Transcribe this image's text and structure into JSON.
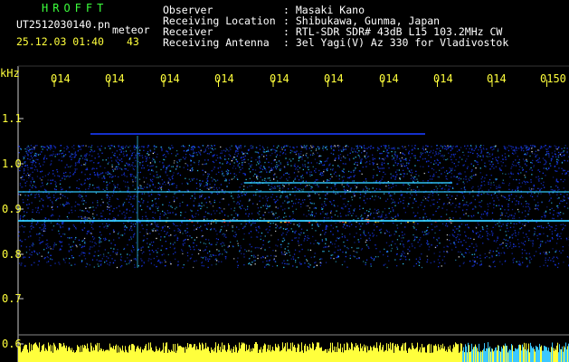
{
  "header": {
    "app_name": "HROFFT",
    "filename": "UT2512030140.pn",
    "meteor_label": "meteor",
    "datetime": "25.12.03 01:40",
    "count": "43"
  },
  "info": {
    "labels": [
      "Observer",
      "Receiving Location",
      "Receiver",
      "Receiving Antenna"
    ],
    "values": [
      ": Masaki Kano",
      ": Shibukawa, Gunma, Japan",
      ": RTL-SDR SDR# 43dB L15 103.2MHz CW",
      ": 3el Yagi(V) Az 330 for Vladivostok"
    ]
  },
  "axes": {
    "y_unit": "kHz",
    "y_ticks": [
      "1.1",
      "1.0",
      "0.9",
      "0.8",
      "0.7",
      "0.6"
    ],
    "time_labels": [
      "014",
      "014",
      "014",
      "014",
      "014",
      "014",
      "014",
      "014",
      "014",
      "0150"
    ]
  },
  "colors": {
    "background": "#000000",
    "header_green": "#3cff3c",
    "header_yellow": "#ffff3c",
    "signal_low": "#1a3cff",
    "signal_mid": "#33ccff",
    "signal_high": "#ffffff",
    "echo_hot": "#ff3030"
  }
}
